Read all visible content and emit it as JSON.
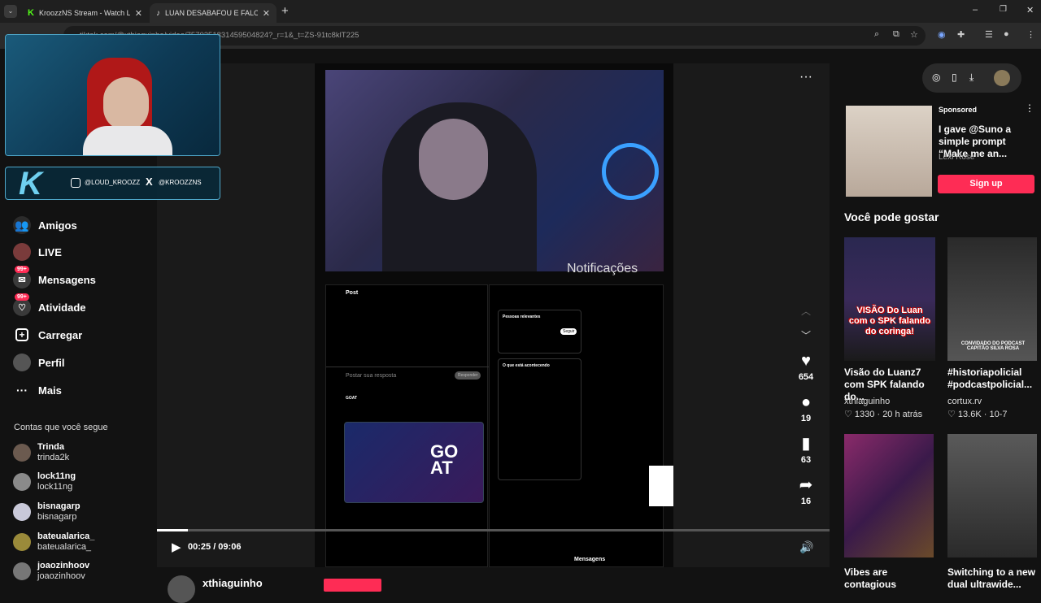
{
  "browser": {
    "tabs": [
      {
        "label": "KroozzNS Stream - Watch Live"
      },
      {
        "label": "LUAN DESABAFOU E FALOU TU"
      }
    ],
    "url": "tiktok.com/@xthiaguinho/video/7570251831459504824?_r=1&_t=ZS-91tc8klT225"
  },
  "overlay": {
    "instagram_handle": "@LOUD_KROOZZ",
    "x_handle": "@KROOZZNS"
  },
  "sidebar": {
    "nav": [
      {
        "label": "Amigos",
        "icon": "friends-icon"
      },
      {
        "label": "LIVE",
        "icon": "live-icon"
      },
      {
        "label": "Mensagens",
        "icon": "messages-icon",
        "badge": "99+"
      },
      {
        "label": "Atividade",
        "icon": "activity-icon",
        "badge": "99+"
      },
      {
        "label": "Carregar",
        "icon": "upload-icon"
      },
      {
        "label": "Perfil",
        "icon": "profile-icon"
      },
      {
        "label": "Mais",
        "icon": "more-icon"
      }
    ],
    "following_header": "Contas que você segue",
    "following": [
      {
        "name": "Trinda",
        "user": "trinda2k"
      },
      {
        "name": "lock11ng",
        "user": "lock11ng"
      },
      {
        "name": "bisnagarp",
        "user": "bisnagarp"
      },
      {
        "name": "bateualarica_",
        "user": "bateualarica_"
      },
      {
        "name": "joaozinhoov",
        "user": "joaozinhoov"
      }
    ]
  },
  "video": {
    "likes": "654",
    "comments": "19",
    "saves": "63",
    "shares": "16",
    "time": "00:25 / 09:06",
    "progress_fraction": 0.046,
    "author": "xthiaguinho",
    "embedded": {
      "notifications_text": "Notificações",
      "post_header": "Post",
      "reply_placeholder": "Postar sua resposta",
      "reply_button": "Responder",
      "relevant_people": "Pessoas relevantes",
      "whats_happening": "O que está acontecendo",
      "messages": "Mensagens",
      "goat_name": "GOAT",
      "follow_btn": "Seguir"
    }
  },
  "right": {
    "sponsored_label": "Sponsored",
    "sponsored_text": "I gave @Suno a simple prompt “Make me an...",
    "sponsored_author": "Lexi Rose",
    "signup": "Sign up",
    "section_title": "Você pode gostar",
    "cards": [
      {
        "title": "Visão do Luanz7 com SPK falando do...",
        "author": "xthiaguinho",
        "likes": "1330",
        "date": "20 h atrás",
        "thumb_text": "VISÃO Do Luan com o SPK falando do coringa!"
      },
      {
        "title": "#historiapolicial #podcastpolicial...",
        "author": "cortux.rv",
        "likes": "13.6K",
        "date": "10-7",
        "thumb_text": "CONVIDADO DO PODCAST CAPITÃO SILVA ROSA"
      },
      {
        "title": "Vibes are contagious",
        "author": "",
        "likes": "",
        "date": ""
      },
      {
        "title": "Switching to a new dual ultrawide...",
        "author": "",
        "likes": "",
        "date": ""
      }
    ]
  }
}
